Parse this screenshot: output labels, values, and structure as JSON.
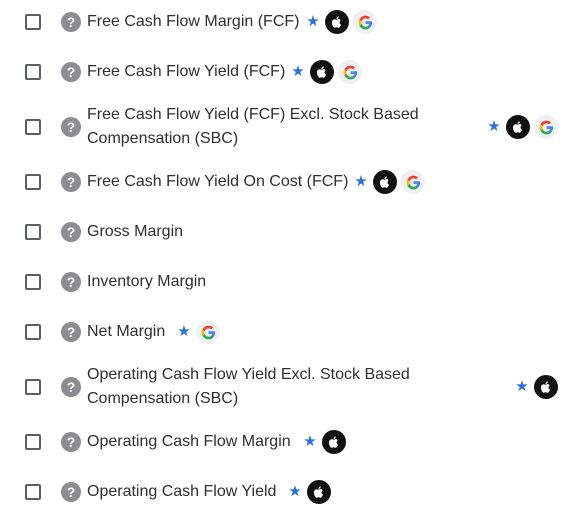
{
  "help_glyph": "?",
  "star_glyph": "★",
  "colors": {
    "star": "#2f6fe4",
    "help_icon_bg": "#8a8d91"
  },
  "items": [
    {
      "label": "Free Cash Flow Margin (FCF)",
      "badges": [
        "star-icon",
        "apple-icon",
        "google-icon"
      ]
    },
    {
      "label": "Free Cash Flow Yield (FCF)",
      "badges": [
        "star-icon",
        "apple-icon",
        "google-icon"
      ]
    },
    {
      "label": "Free Cash Flow Yield (FCF) Excl. Stock Based Compensation (SBC)",
      "badges": [
        "star-icon",
        "apple-icon",
        "google-icon"
      ]
    },
    {
      "label": "Free Cash Flow Yield On Cost (FCF)",
      "badges": [
        "star-icon",
        "apple-icon",
        "google-icon"
      ]
    },
    {
      "label": "Gross Margin",
      "badges": []
    },
    {
      "label": "Inventory Margin",
      "badges": []
    },
    {
      "label": "Net Margin",
      "badges": [
        "star-icon",
        "google-icon"
      ]
    },
    {
      "label": "Operating Cash Flow Yield Excl. Stock Based Compensation (SBC)",
      "badges": [
        "star-icon",
        "apple-icon"
      ]
    },
    {
      "label": "Operating Cash Flow Margin",
      "badges": [
        "star-icon",
        "apple-icon"
      ]
    },
    {
      "label": "Operating Cash Flow Yield",
      "badges": [
        "star-icon",
        "apple-icon"
      ]
    }
  ]
}
